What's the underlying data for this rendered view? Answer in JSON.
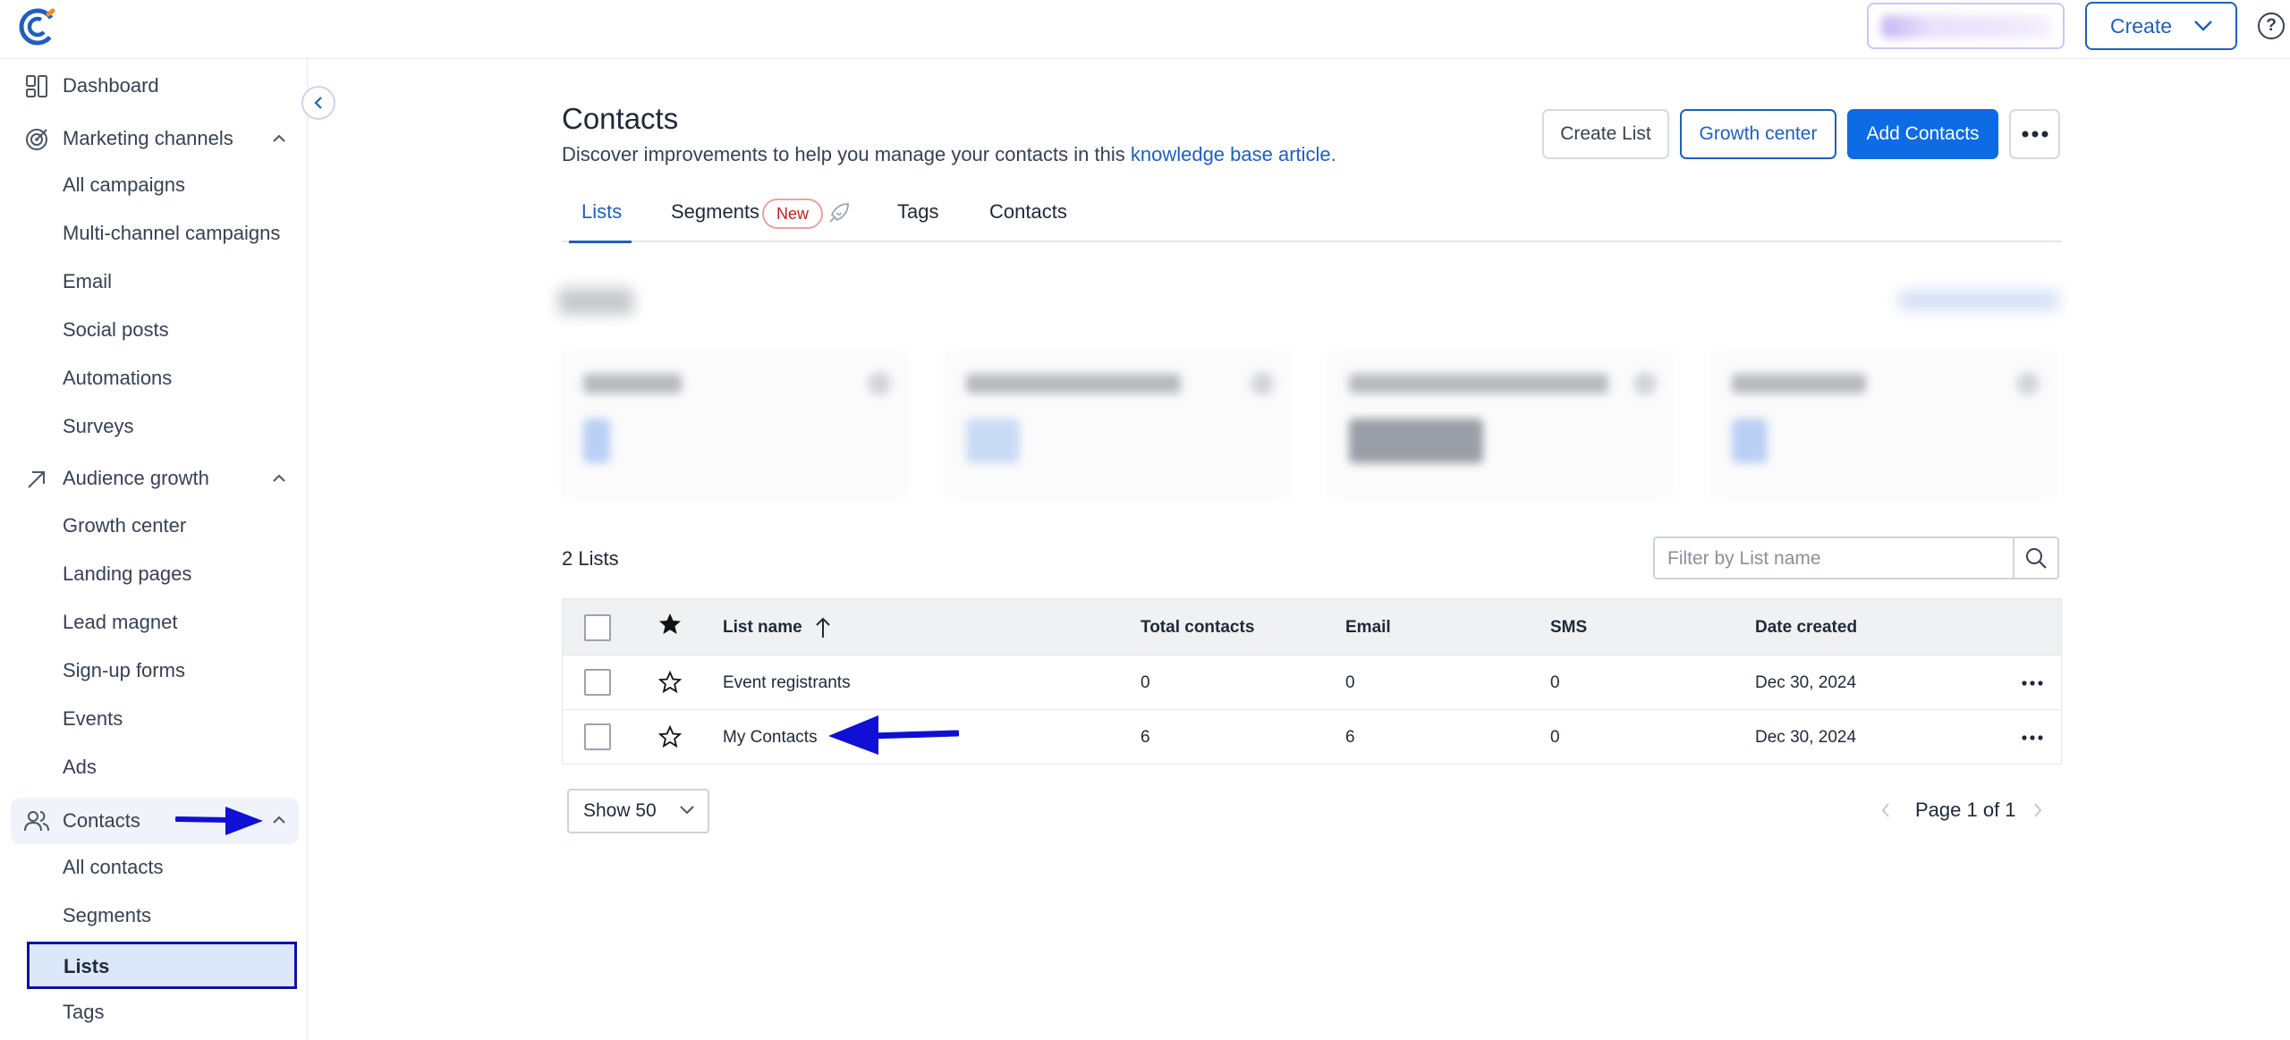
{
  "topbar": {
    "upgrade_label": "",
    "create_label": "Create",
    "help_symbol": "?"
  },
  "sidebar": {
    "dashboard": "Dashboard",
    "marketing_channels": "Marketing channels",
    "marketing_items": [
      "All campaigns",
      "Multi-channel campaigns",
      "Email",
      "Social posts",
      "Automations",
      "Surveys"
    ],
    "audience_growth": "Audience growth",
    "audience_items": [
      "Growth center",
      "Landing pages",
      "Lead magnet",
      "Sign-up forms",
      "Events",
      "Ads"
    ],
    "contacts": "Contacts",
    "contacts_items": [
      "All contacts",
      "Segments",
      "Lists",
      "Tags"
    ]
  },
  "header": {
    "title": "Contacts",
    "subtitle": "Discover improvements to help you manage your contacts in this ",
    "subtitle_link": "knowledge base article.",
    "create_list": "Create List",
    "growth_center": "Growth center",
    "add_contacts": "Add Contacts"
  },
  "tabs": {
    "lists": "Lists",
    "segments": "Segments",
    "new_badge": "New",
    "tags": "Tags",
    "contacts": "Contacts"
  },
  "lists_count": "2 Lists",
  "filter": {
    "placeholder": "Filter by List name"
  },
  "table": {
    "columns": [
      "List name",
      "Total contacts",
      "Email",
      "SMS",
      "Date created"
    ],
    "rows": [
      {
        "name": "Event registrants",
        "total": "0",
        "email": "0",
        "sms": "0",
        "date": "Dec 30, 2024"
      },
      {
        "name": "My Contacts",
        "total": "6",
        "email": "6",
        "sms": "0",
        "date": "Dec 30, 2024"
      }
    ]
  },
  "pagination": {
    "show_label": "Show 50",
    "page_label": "Page 1 of 1"
  },
  "colors": {
    "brand_blue": "#0d6be3",
    "link_blue": "#1f5fbf",
    "annotation_blue": "#0f0fd6",
    "badge_red": "#c81e1e"
  }
}
